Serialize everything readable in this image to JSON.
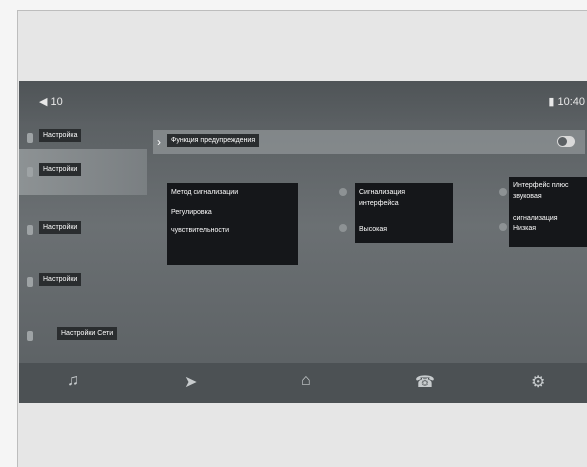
{
  "status_bar": {
    "volume": "◀ 10",
    "time": "▮ 10:40"
  },
  "sidebar": {
    "items": [
      {
        "label": "Настройка",
        "icon": "bars-icon"
      },
      {
        "label": "Настройки",
        "icon": "car-icon",
        "active": true
      },
      {
        "label": "Настройки",
        "icon": "display-icon"
      },
      {
        "label": "Настройки",
        "icon": "speaker-icon"
      },
      {
        "label": "Настройки Сети",
        "icon": "wifi-icon"
      }
    ]
  },
  "content": {
    "header_chevron": "›",
    "header_title": "Функция предупреждения",
    "toggle_on": true,
    "left_block": {
      "line1": "Метод сигнализации",
      "line2": "Регулировка",
      "line3": "чувствительности"
    },
    "mid_block": {
      "opt1_line1": "Сигнализация",
      "opt1_line2": "интерфейса",
      "opt2": "Высокая"
    },
    "right_block": {
      "opt1_line1": "Интерфейс плюс",
      "opt1_line2": "звуковая",
      "opt2_line1": "сигнализация",
      "opt2_line2": "Низкая"
    }
  },
  "bottom_nav": {
    "items": [
      {
        "icon": "music-note-icon",
        "glyph": "♫"
      },
      {
        "icon": "navigation-arrow-icon",
        "glyph": "➤"
      },
      {
        "icon": "home-icon",
        "glyph": "⌂"
      },
      {
        "icon": "phone-icon",
        "glyph": "☎"
      },
      {
        "icon": "settings-gear-icon",
        "glyph": "⚙"
      }
    ]
  }
}
